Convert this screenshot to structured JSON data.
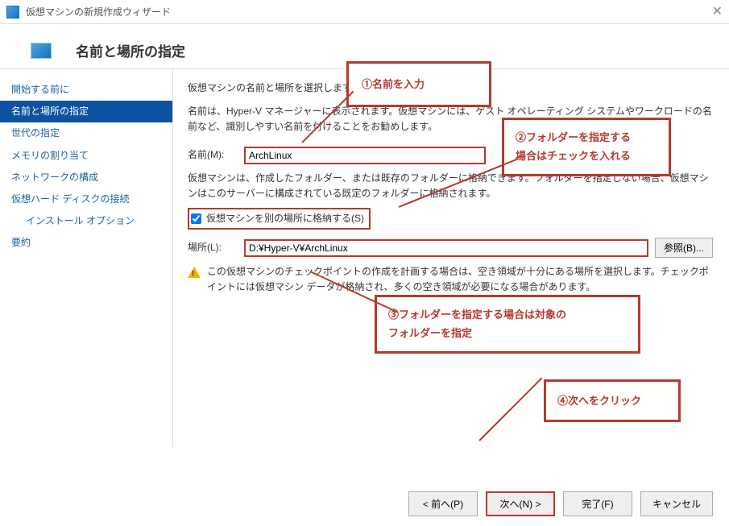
{
  "window": {
    "title": "仮想マシンの新規作成ウィザード",
    "close": "✕"
  },
  "header": {
    "title": "名前と場所の指定"
  },
  "sidebar": {
    "items": [
      {
        "label": "開始する前に"
      },
      {
        "label": "名前と場所の指定",
        "selected": true
      },
      {
        "label": "世代の指定"
      },
      {
        "label": "メモリの割り当て"
      },
      {
        "label": "ネットワークの構成"
      },
      {
        "label": "仮想ハード ディスクの接続"
      },
      {
        "label": "インストール オプション",
        "sub": true
      },
      {
        "label": "要約"
      }
    ]
  },
  "content": {
    "intro1": "仮想マシンの名前と場所を選択します。",
    "intro2": "名前は、Hyper-V マネージャーに表示されます。仮想マシンには、ゲスト オペレーティング システムやワークロードの名前など、識別しやすい名前を付けることをお勧めします。",
    "name_label": "名前(M):",
    "name_value": "ArchLinux",
    "store_desc1": "仮想マシンは、作成したフォルダー、または既存のフォルダーに格納できます。フォルダーを指定しない場合、仮想マシンはこのサーバーに構成されている既定のフォルダーに格納されます。",
    "store_checkbox": "仮想マシンを別の場所に格納する(S)",
    "location_label": "場所(L):",
    "location_value": "D:¥Hyper-V¥ArchLinux",
    "browse": "参照(B)...",
    "warning": "この仮想マシンのチェックポイントの作成を計画する場合は、空き領域が十分にある場所を選択します。チェックポイントには仮想マシン データが格納され、多くの空き領域が必要になる場合があります。"
  },
  "callouts": {
    "c1": "①名前を入力",
    "c2_l1": "②フォルダーを指定する",
    "c2_l2": "場合はチェックを入れる",
    "c3_l1": "③フォルダーを指定する場合は対象の",
    "c3_l2": "フォルダーを指定",
    "c4": "④次へをクリック"
  },
  "footer": {
    "prev": "< 前へ(P)",
    "next": "次へ(N) >",
    "finish": "完了(F)",
    "cancel": "キャンセル"
  }
}
